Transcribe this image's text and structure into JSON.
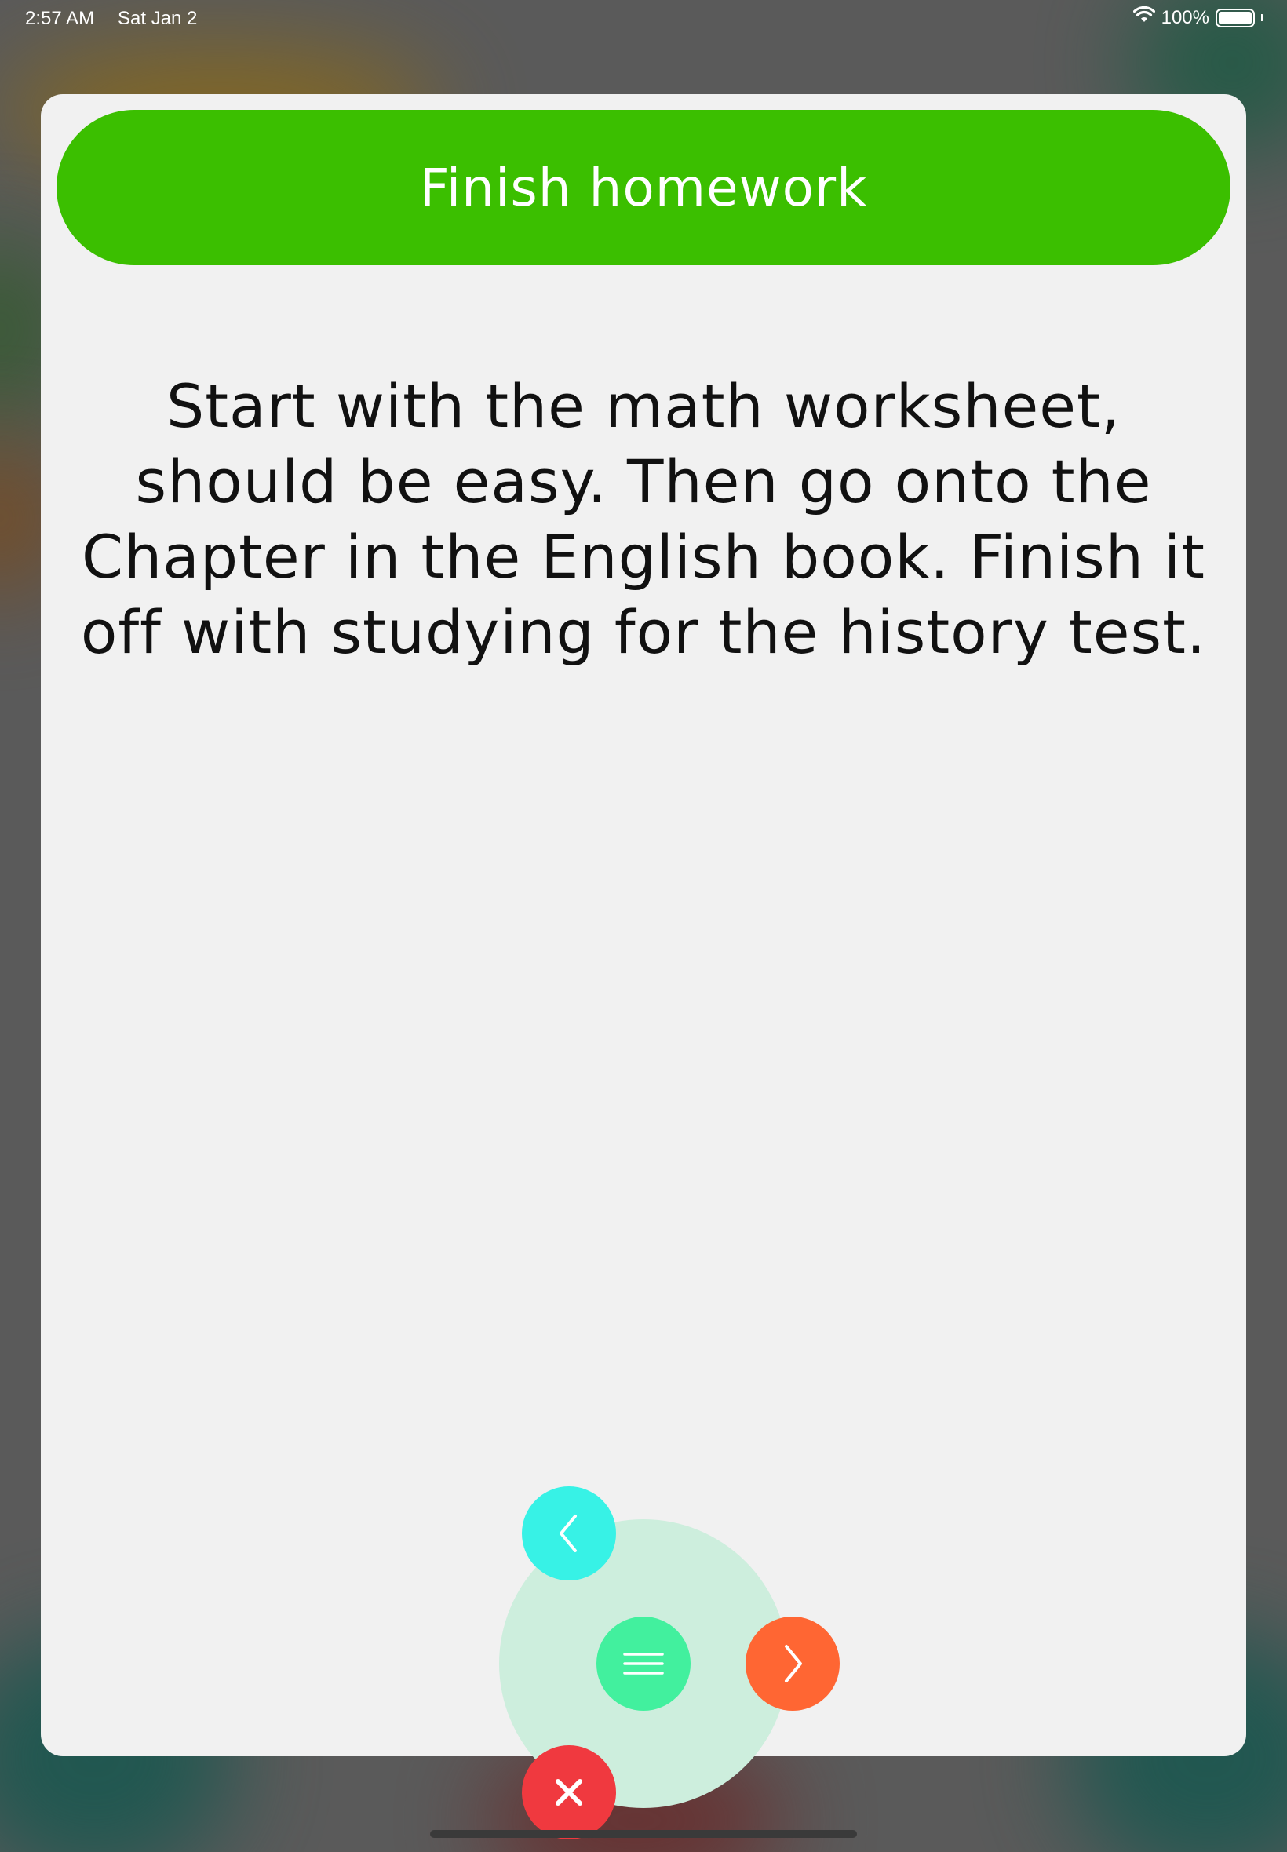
{
  "status_bar": {
    "time": "2:57 AM",
    "date": "Sat Jan 2",
    "battery_percent": "100%",
    "battery_level": 1.0,
    "wifi_icon": "wifi-icon",
    "battery_icon": "battery-icon"
  },
  "task": {
    "title": "Finish homework",
    "description": "Start with the math worksheet, should be easy. Then go onto the Chapter in the English book. Finish it off with studying for the history test."
  },
  "menu": {
    "back_icon": "chevron-left-icon",
    "menu_icon": "hamburger-icon",
    "next_icon": "chevron-right-icon",
    "close_icon": "close-icon"
  },
  "colors": {
    "title_bar": "#3bbf00",
    "back_button": "#37f2e6",
    "menu_button": "#42f09e",
    "next_button": "#ff6633",
    "close_button": "#f0393f",
    "card_background": "#f1f1f1"
  }
}
